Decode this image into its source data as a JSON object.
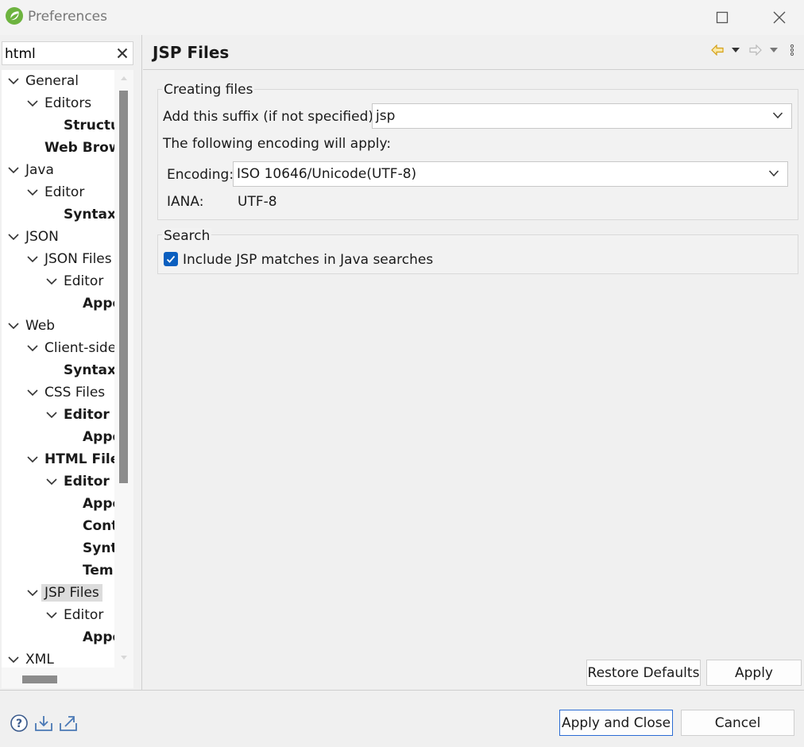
{
  "window": {
    "title": "Preferences"
  },
  "filter": {
    "value": "html"
  },
  "tree": [
    {
      "label": "General",
      "indent": 0,
      "bold": false
    },
    {
      "label": "Editors",
      "indent": 1,
      "bold": false
    },
    {
      "label": "Structu",
      "indent": 2,
      "bold": true,
      "leaf": true
    },
    {
      "label": "Web Brow",
      "indent": 1,
      "bold": true,
      "leaf": true
    },
    {
      "label": "Java",
      "indent": 0,
      "bold": false
    },
    {
      "label": "Editor",
      "indent": 1,
      "bold": false
    },
    {
      "label": "Syntax",
      "indent": 2,
      "bold": true,
      "leaf": true
    },
    {
      "label": "JSON",
      "indent": 0,
      "bold": false
    },
    {
      "label": "JSON Files",
      "indent": 1,
      "bold": false
    },
    {
      "label": "Editor",
      "indent": 2,
      "bold": false
    },
    {
      "label": "Appe",
      "indent": 3,
      "bold": true,
      "leaf": true
    },
    {
      "label": "Web",
      "indent": 0,
      "bold": false
    },
    {
      "label": "Client-side",
      "indent": 1,
      "bold": false
    },
    {
      "label": "Syntax",
      "indent": 2,
      "bold": true,
      "leaf": true
    },
    {
      "label": "CSS Files",
      "indent": 1,
      "bold": false
    },
    {
      "label": "Editor",
      "indent": 2,
      "bold": true
    },
    {
      "label": "Appe",
      "indent": 3,
      "bold": true,
      "leaf": true
    },
    {
      "label": "HTML Files",
      "indent": 1,
      "bold": true
    },
    {
      "label": "Editor",
      "indent": 2,
      "bold": true
    },
    {
      "label": "Appe",
      "indent": 3,
      "bold": true,
      "leaf": true
    },
    {
      "label": "Cont",
      "indent": 3,
      "bold": true,
      "leaf": true
    },
    {
      "label": "Synt",
      "indent": 3,
      "bold": true,
      "leaf": true
    },
    {
      "label": "Temp",
      "indent": 3,
      "bold": true,
      "leaf": true
    },
    {
      "label": "JSP Files",
      "indent": 1,
      "bold": false,
      "selected": true
    },
    {
      "label": "Editor",
      "indent": 2,
      "bold": false
    },
    {
      "label": "Appe",
      "indent": 3,
      "bold": true,
      "leaf": true
    },
    {
      "label": "XML",
      "indent": 0,
      "bold": false
    }
  ],
  "page": {
    "title": "JSP Files"
  },
  "creating": {
    "title": "Creating files",
    "suffix_label": "Add this suffix (if not specified):",
    "suffix_value": "jsp",
    "encoding_intro": "The following encoding will apply:",
    "encoding_label": "Encoding:",
    "encoding_value": "ISO 10646/Unicode(UTF-8)",
    "iana_label": "IANA:",
    "iana_value": "UTF-8"
  },
  "search": {
    "title": "Search",
    "include_label": "Include JSP matches in Java searches",
    "include_checked": true
  },
  "buttons": {
    "restore_defaults": "Restore Defaults",
    "apply": "Apply",
    "apply_and_close": "Apply and Close",
    "cancel": "Cancel"
  },
  "colors": {
    "accent": "#0b5fbf",
    "nav_arrow": "#d4a017",
    "selection": "#dcdcdc"
  },
  "icons": [
    "spring-logo-icon",
    "minimize-icon",
    "maximize-icon",
    "close-icon",
    "clear-filter-icon",
    "back-arrow-icon",
    "forward-arrow-icon",
    "view-menu-icon",
    "help-icon",
    "import-icon",
    "export-icon"
  ]
}
